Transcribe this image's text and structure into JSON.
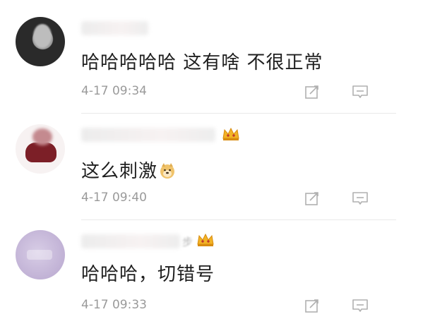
{
  "comments": [
    {
      "text": "哈哈哈哈哈 这有啥 不很正常",
      "time": "4-17 09:34",
      "badge": ""
    },
    {
      "text": "这么刺激",
      "emoji": "doge-emoji",
      "time": "4-17 09:40",
      "badge": "crown-badge"
    },
    {
      "text": "哈哈哈，切错号",
      "time": "4-17 09:33",
      "name_tail": "步",
      "badge": "crown-badge"
    }
  ],
  "icons": {
    "edit": "edit-icon",
    "reply": "comment-icon",
    "crown": "crown-icon"
  },
  "colors": {
    "text": "#1f1f1f",
    "time": "#9a9a9a",
    "icon": "#b0b0b0",
    "crown": "#e8a11a"
  }
}
